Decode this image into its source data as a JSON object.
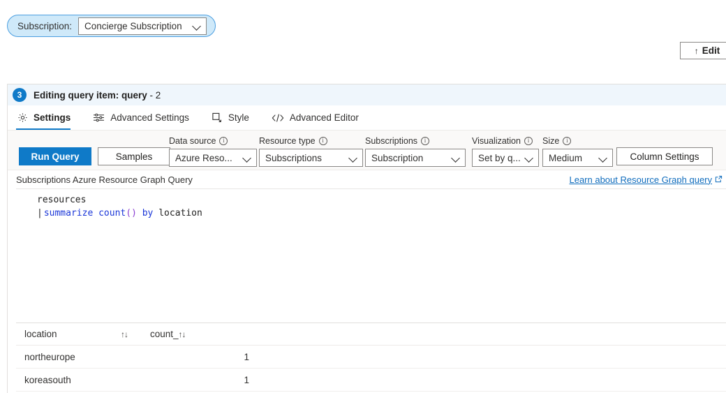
{
  "subscription_bar": {
    "label": "Subscription:",
    "selected": "Concierge Subscription",
    "chevron_icon": "chevron-down-icon"
  },
  "edit_button": {
    "label": "Edit",
    "arrow_glyph": "↑"
  },
  "panel": {
    "step_number": "3",
    "title_main": "Editing query item: query",
    "title_suffix": " - 2",
    "tabs": [
      {
        "label": "Settings",
        "icon": "gear-icon",
        "active": true
      },
      {
        "label": "Advanced Settings",
        "icon": "sliders-icon",
        "active": false
      },
      {
        "label": "Style",
        "icon": "style-square-icon",
        "active": false
      },
      {
        "label": "Advanced Editor",
        "icon": "code-brackets-icon",
        "active": false
      }
    ]
  },
  "toolbar": {
    "run_query_label": "Run Query",
    "samples_label": "Samples",
    "column_settings_label": "Column Settings",
    "fields": [
      {
        "label": "Data source",
        "value": "Azure Reso...",
        "info_icon": "info-icon"
      },
      {
        "label": "Resource type",
        "value": "Subscriptions",
        "info_icon": "info-icon"
      },
      {
        "label": "Subscriptions",
        "value": "Subscription",
        "info_icon": "info-icon"
      },
      {
        "label": "Visualization",
        "value": "Set by q...",
        "info_icon": "info-icon"
      },
      {
        "label": "Size",
        "value": "Medium",
        "info_icon": "info-icon"
      }
    ]
  },
  "query_meta": {
    "description": "Subscriptions Azure Resource Graph Query",
    "learn_link": "Learn about Resource Graph query",
    "external_icon": "external-link-icon"
  },
  "editor": {
    "line1": "resources",
    "line2_pipe": "|",
    "line2_kw1": "summarize",
    "line2_fn": "count",
    "line2_parens": "()",
    "line2_kw2": "by",
    "line2_field": "location"
  },
  "results": {
    "columns": [
      {
        "label": "location",
        "sort_icon": "sort-arrows-icon"
      },
      {
        "label": "count_",
        "sort_icon": "sort-arrows-icon"
      }
    ],
    "sort_glyph": "↑↓",
    "rows": [
      {
        "location": "northeurope",
        "count": "1"
      },
      {
        "location": "koreasouth",
        "count": "1"
      }
    ]
  },
  "colors": {
    "accent_blue": "#0f7ac8",
    "link_blue": "#0f6cbd",
    "header_bg": "#eff6fc",
    "pill_bg": "#cfe9f9",
    "toolbar_bg": "#faf9f8"
  }
}
